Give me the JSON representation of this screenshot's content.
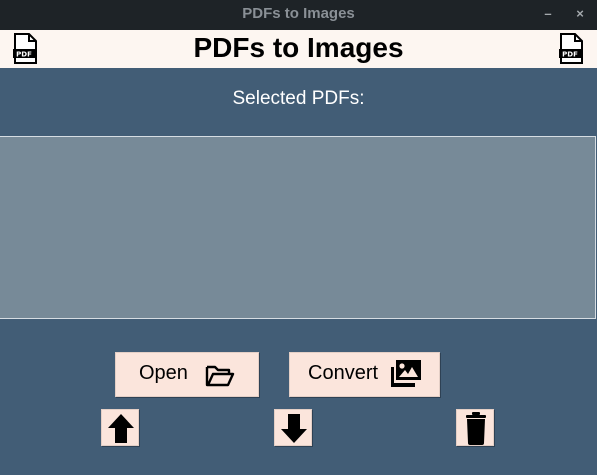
{
  "window": {
    "title": "PDFs to Images",
    "minimize_label": "–",
    "close_label": "×"
  },
  "header": {
    "title": "PDFs to Images",
    "left_icon": "pdf-file-icon",
    "right_icon": "pdf-file-icon"
  },
  "selected": {
    "label": "Selected PDFs:",
    "items": []
  },
  "buttons": {
    "open_label": "Open",
    "open_icon": "folder-open-icon",
    "convert_label": "Convert",
    "convert_icon": "images-icon",
    "move_up_icon": "arrow-up-icon",
    "move_down_icon": "arrow-down-icon",
    "delete_icon": "trash-icon"
  },
  "colors": {
    "background": "#425d76",
    "header_bg": "#fdf6f1",
    "listbox_bg": "#778a98",
    "button_bg": "#fbe5dc",
    "titlebar_bg": "#1e2327"
  }
}
